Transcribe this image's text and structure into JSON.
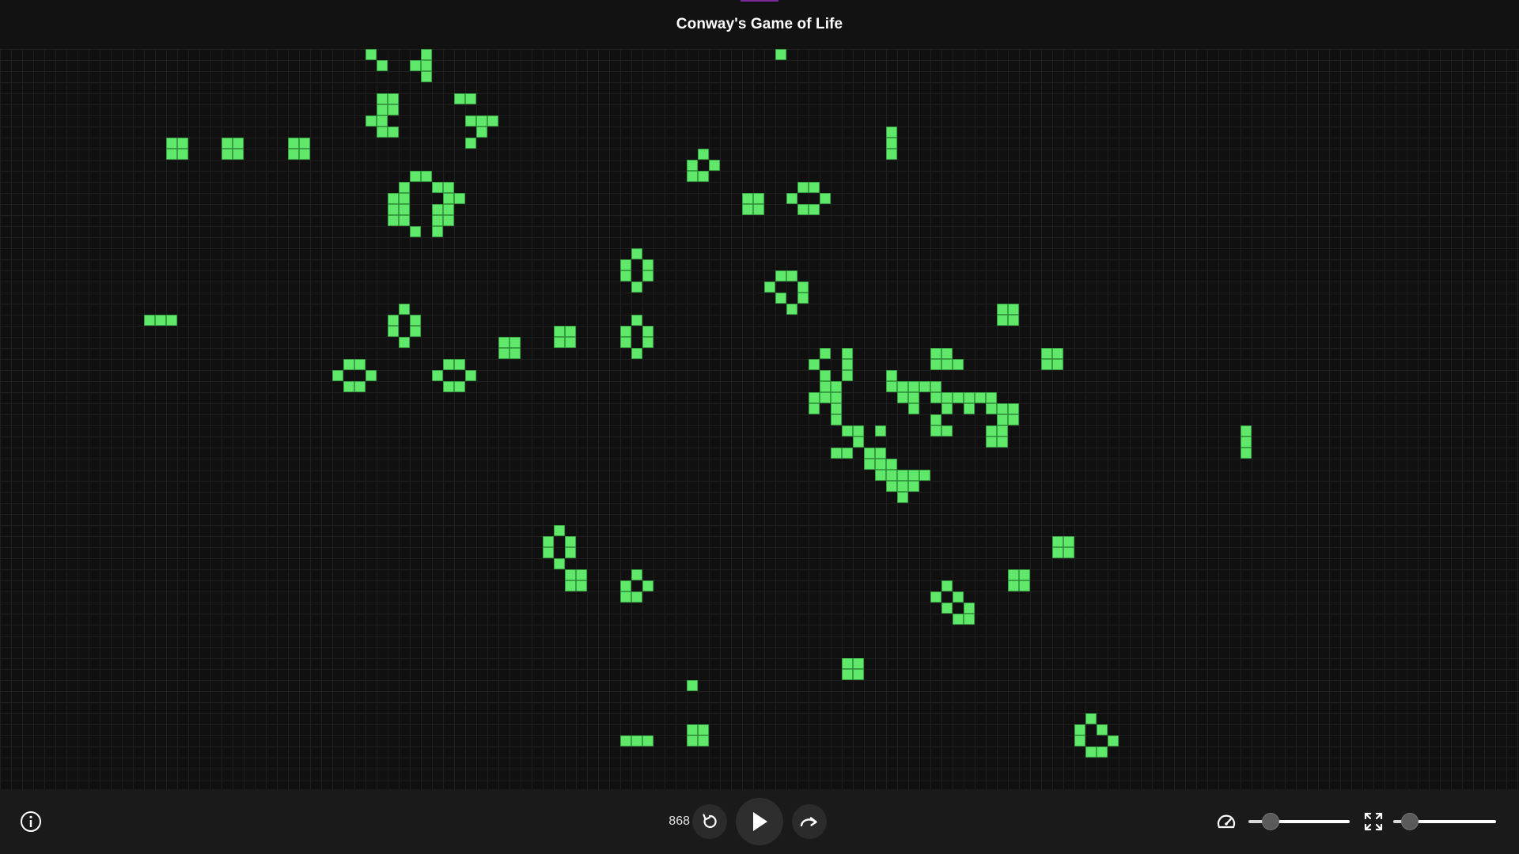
{
  "header": {
    "title": "Conway's Game of Life"
  },
  "board": {
    "cell_color": "#5fe86a",
    "cell_border": "#3aa845",
    "grid_color": "#1f1f1f",
    "background": "#101010",
    "live_cells": [
      [
        33,
        0
      ],
      [
        34,
        1
      ],
      [
        38,
        0
      ],
      [
        38,
        1
      ],
      [
        37,
        1
      ],
      [
        38,
        2
      ],
      [
        70,
        0
      ],
      [
        34,
        4
      ],
      [
        35,
        4
      ],
      [
        34,
        5
      ],
      [
        35,
        5
      ],
      [
        33,
        6
      ],
      [
        34,
        6
      ],
      [
        34,
        7
      ],
      [
        35,
        7
      ],
      [
        41,
        4
      ],
      [
        42,
        4
      ],
      [
        42,
        6
      ],
      [
        43,
        6
      ],
      [
        44,
        6
      ],
      [
        43,
        7
      ],
      [
        42,
        8
      ],
      [
        15,
        8
      ],
      [
        16,
        8
      ],
      [
        15,
        9
      ],
      [
        16,
        9
      ],
      [
        20,
        8
      ],
      [
        21,
        8
      ],
      [
        20,
        9
      ],
      [
        21,
        9
      ],
      [
        26,
        8
      ],
      [
        27,
        8
      ],
      [
        26,
        9
      ],
      [
        27,
        9
      ],
      [
        80,
        7
      ],
      [
        80,
        8
      ],
      [
        80,
        9
      ],
      [
        63,
        9
      ],
      [
        62,
        10
      ],
      [
        64,
        10
      ],
      [
        62,
        11
      ],
      [
        63,
        11
      ],
      [
        37,
        11
      ],
      [
        38,
        11
      ],
      [
        36,
        12
      ],
      [
        39,
        12
      ],
      [
        40,
        12
      ],
      [
        35,
        13
      ],
      [
        36,
        13
      ],
      [
        40,
        13
      ],
      [
        41,
        13
      ],
      [
        35,
        14
      ],
      [
        36,
        14
      ],
      [
        39,
        14
      ],
      [
        40,
        14
      ],
      [
        35,
        15
      ],
      [
        36,
        15
      ],
      [
        39,
        15
      ],
      [
        40,
        15
      ],
      [
        37,
        16
      ],
      [
        39,
        16
      ],
      [
        72,
        12
      ],
      [
        73,
        12
      ],
      [
        71,
        13
      ],
      [
        74,
        13
      ],
      [
        72,
        14
      ],
      [
        73,
        14
      ],
      [
        67,
        13
      ],
      [
        68,
        13
      ],
      [
        67,
        14
      ],
      [
        68,
        14
      ],
      [
        57,
        18
      ],
      [
        56,
        19
      ],
      [
        58,
        19
      ],
      [
        56,
        20
      ],
      [
        58,
        20
      ],
      [
        57,
        21
      ],
      [
        70,
        20
      ],
      [
        71,
        20
      ],
      [
        69,
        21
      ],
      [
        72,
        21
      ],
      [
        70,
        22
      ],
      [
        72,
        22
      ],
      [
        71,
        23
      ],
      [
        13,
        24
      ],
      [
        14,
        24
      ],
      [
        15,
        24
      ],
      [
        90,
        23
      ],
      [
        91,
        23
      ],
      [
        90,
        24
      ],
      [
        91,
        24
      ],
      [
        36,
        23
      ],
      [
        35,
        24
      ],
      [
        37,
        24
      ],
      [
        35,
        25
      ],
      [
        37,
        25
      ],
      [
        36,
        26
      ],
      [
        57,
        24
      ],
      [
        56,
        25
      ],
      [
        58,
        25
      ],
      [
        56,
        26
      ],
      [
        58,
        26
      ],
      [
        57,
        27
      ],
      [
        45,
        26
      ],
      [
        46,
        26
      ],
      [
        45,
        27
      ],
      [
        46,
        27
      ],
      [
        50,
        25
      ],
      [
        51,
        25
      ],
      [
        50,
        26
      ],
      [
        51,
        26
      ],
      [
        74,
        27
      ],
      [
        76,
        27
      ],
      [
        73,
        28
      ],
      [
        76,
        28
      ],
      [
        74,
        29
      ],
      [
        76,
        29
      ],
      [
        80,
        29
      ],
      [
        84,
        27
      ],
      [
        85,
        27
      ],
      [
        84,
        28
      ],
      [
        85,
        28
      ],
      [
        86,
        28
      ],
      [
        94,
        27
      ],
      [
        95,
        27
      ],
      [
        94,
        28
      ],
      [
        95,
        28
      ],
      [
        31,
        28
      ],
      [
        32,
        28
      ],
      [
        30,
        29
      ],
      [
        33,
        29
      ],
      [
        31,
        30
      ],
      [
        32,
        30
      ],
      [
        40,
        28
      ],
      [
        41,
        28
      ],
      [
        39,
        29
      ],
      [
        42,
        29
      ],
      [
        40,
        30
      ],
      [
        41,
        30
      ],
      [
        74,
        30
      ],
      [
        75,
        30
      ],
      [
        80,
        30
      ],
      [
        81,
        30
      ],
      [
        82,
        30
      ],
      [
        83,
        30
      ],
      [
        84,
        30
      ],
      [
        73,
        31
      ],
      [
        74,
        31
      ],
      [
        75,
        31
      ],
      [
        81,
        31
      ],
      [
        82,
        31
      ],
      [
        84,
        31
      ],
      [
        85,
        31
      ],
      [
        86,
        31
      ],
      [
        87,
        31
      ],
      [
        88,
        31
      ],
      [
        89,
        31
      ],
      [
        73,
        32
      ],
      [
        75,
        32
      ],
      [
        82,
        32
      ],
      [
        85,
        32
      ],
      [
        87,
        32
      ],
      [
        89,
        32
      ],
      [
        90,
        32
      ],
      [
        91,
        32
      ],
      [
        84,
        33
      ],
      [
        90,
        33
      ],
      [
        91,
        33
      ],
      [
        75,
        33
      ],
      [
        76,
        34
      ],
      [
        77,
        34
      ],
      [
        79,
        34
      ],
      [
        84,
        34
      ],
      [
        85,
        34
      ],
      [
        89,
        34
      ],
      [
        90,
        34
      ],
      [
        77,
        35
      ],
      [
        89,
        35
      ],
      [
        90,
        35
      ],
      [
        112,
        34
      ],
      [
        112,
        35
      ],
      [
        112,
        36
      ],
      [
        75,
        36
      ],
      [
        76,
        36
      ],
      [
        78,
        36
      ],
      [
        79,
        36
      ],
      [
        78,
        37
      ],
      [
        79,
        37
      ],
      [
        80,
        37
      ],
      [
        79,
        38
      ],
      [
        80,
        38
      ],
      [
        81,
        38
      ],
      [
        82,
        38
      ],
      [
        83,
        38
      ],
      [
        80,
        39
      ],
      [
        81,
        39
      ],
      [
        82,
        39
      ],
      [
        81,
        40
      ],
      [
        50,
        43
      ],
      [
        49,
        44
      ],
      [
        51,
        44
      ],
      [
        49,
        45
      ],
      [
        51,
        45
      ],
      [
        50,
        46
      ],
      [
        95,
        44
      ],
      [
        96,
        44
      ],
      [
        95,
        45
      ],
      [
        96,
        45
      ],
      [
        51,
        47
      ],
      [
        52,
        47
      ],
      [
        51,
        48
      ],
      [
        52,
        48
      ],
      [
        57,
        47
      ],
      [
        56,
        48
      ],
      [
        58,
        48
      ],
      [
        56,
        49
      ],
      [
        57,
        49
      ],
      [
        91,
        47
      ],
      [
        92,
        47
      ],
      [
        91,
        48
      ],
      [
        92,
        48
      ],
      [
        85,
        48
      ],
      [
        84,
        49
      ],
      [
        86,
        49
      ],
      [
        85,
        50
      ],
      [
        87,
        50
      ],
      [
        86,
        51
      ],
      [
        87,
        51
      ],
      [
        76,
        55
      ],
      [
        77,
        55
      ],
      [
        76,
        56
      ],
      [
        77,
        56
      ],
      [
        62,
        57
      ],
      [
        62,
        61
      ],
      [
        63,
        61
      ],
      [
        62,
        62
      ],
      [
        63,
        62
      ],
      [
        56,
        62
      ],
      [
        57,
        62
      ],
      [
        58,
        62
      ],
      [
        98,
        60
      ],
      [
        97,
        61
      ],
      [
        99,
        61
      ],
      [
        97,
        62
      ],
      [
        100,
        62
      ],
      [
        98,
        63
      ],
      [
        99,
        63
      ]
    ]
  },
  "footer": {
    "info_icon": "info-icon",
    "generation": "868",
    "reset_icon": "reset-icon",
    "play_icon": "play-icon",
    "step_icon": "step-forward-icon",
    "speed_icon": "speedometer-icon",
    "speed_level": 0.22,
    "fullscreen_icon": "fullscreen-icon",
    "zoom_level": 0.16
  }
}
